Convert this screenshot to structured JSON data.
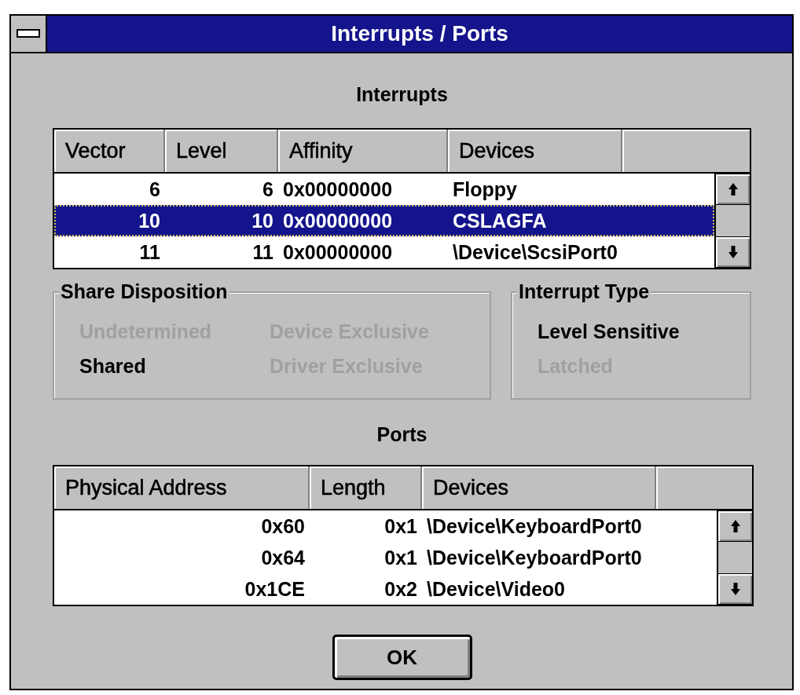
{
  "window": {
    "title": "Interrupts / Ports"
  },
  "interrupts": {
    "heading": "Interrupts",
    "columns": [
      "Vector",
      "Level",
      "Affinity",
      "Devices"
    ],
    "rows": [
      {
        "cells": [
          "6",
          "6",
          "0x00000000",
          "Floppy"
        ],
        "selected": false
      },
      {
        "cells": [
          "10",
          "10",
          "0x00000000",
          "CSLAGFA"
        ],
        "selected": true
      },
      {
        "cells": [
          "11",
          "11",
          "0x00000000",
          "\\Device\\ScsiPort0"
        ],
        "selected": false
      }
    ]
  },
  "share_disposition": {
    "title": "Share Disposition",
    "options": [
      {
        "label": "Undetermined",
        "disabled": true
      },
      {
        "label": "Device Exclusive",
        "disabled": true
      },
      {
        "label": "Shared",
        "disabled": false
      },
      {
        "label": "Driver Exclusive",
        "disabled": true
      }
    ]
  },
  "interrupt_type": {
    "title": "Interrupt Type",
    "options": [
      {
        "label": "Level Sensitive",
        "disabled": false
      },
      {
        "label": "Latched",
        "disabled": true
      }
    ]
  },
  "ports": {
    "heading": "Ports",
    "columns": [
      "Physical Address",
      "Length",
      "Devices"
    ],
    "rows": [
      {
        "cells": [
          "0x60",
          "0x1",
          "\\Device\\KeyboardPort0"
        ],
        "selected": false
      },
      {
        "cells": [
          "0x64",
          "0x1",
          "\\Device\\KeyboardPort0"
        ],
        "selected": false
      },
      {
        "cells": [
          "0x1CE",
          "0x2",
          "\\Device\\Video0"
        ],
        "selected": false
      }
    ]
  },
  "buttons": [
    "OK"
  ]
}
